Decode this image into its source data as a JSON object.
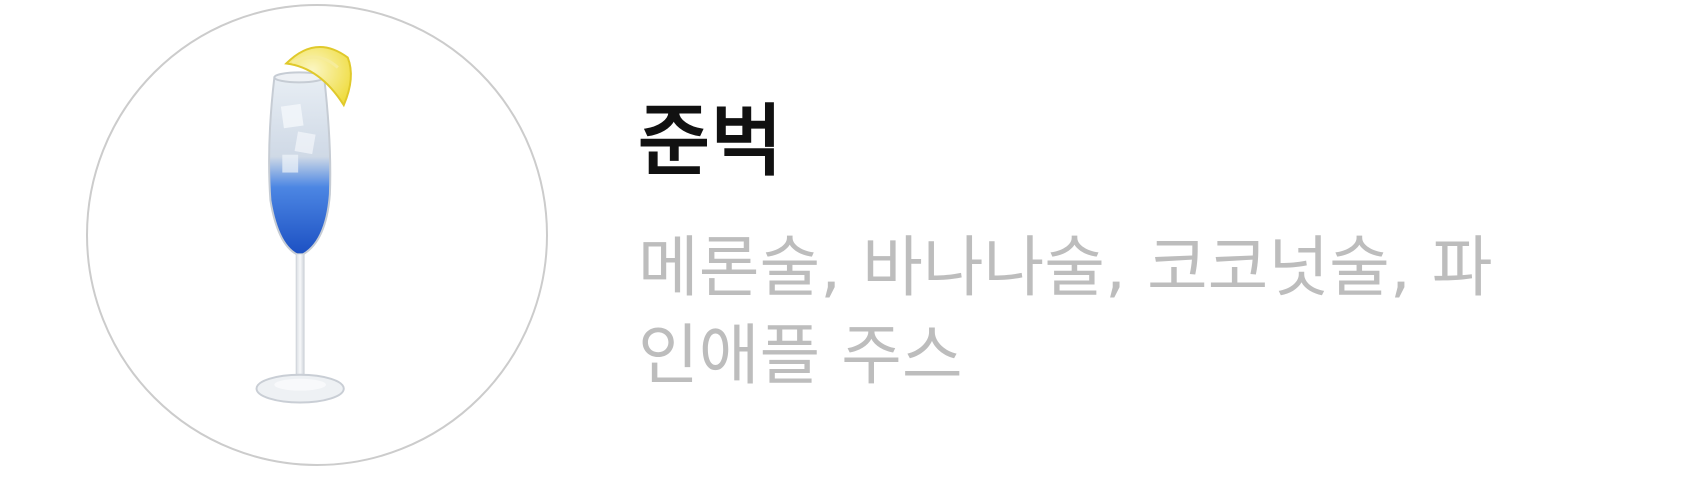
{
  "item": {
    "name": "준벅",
    "description": "메론술, 바나나술, 코코넛술, 파인애플 주스"
  },
  "photo": {
    "icon": "cocktail-glass-photo",
    "liquid_color": "#1f5fd6",
    "garnish_color": "#f3e35c"
  }
}
